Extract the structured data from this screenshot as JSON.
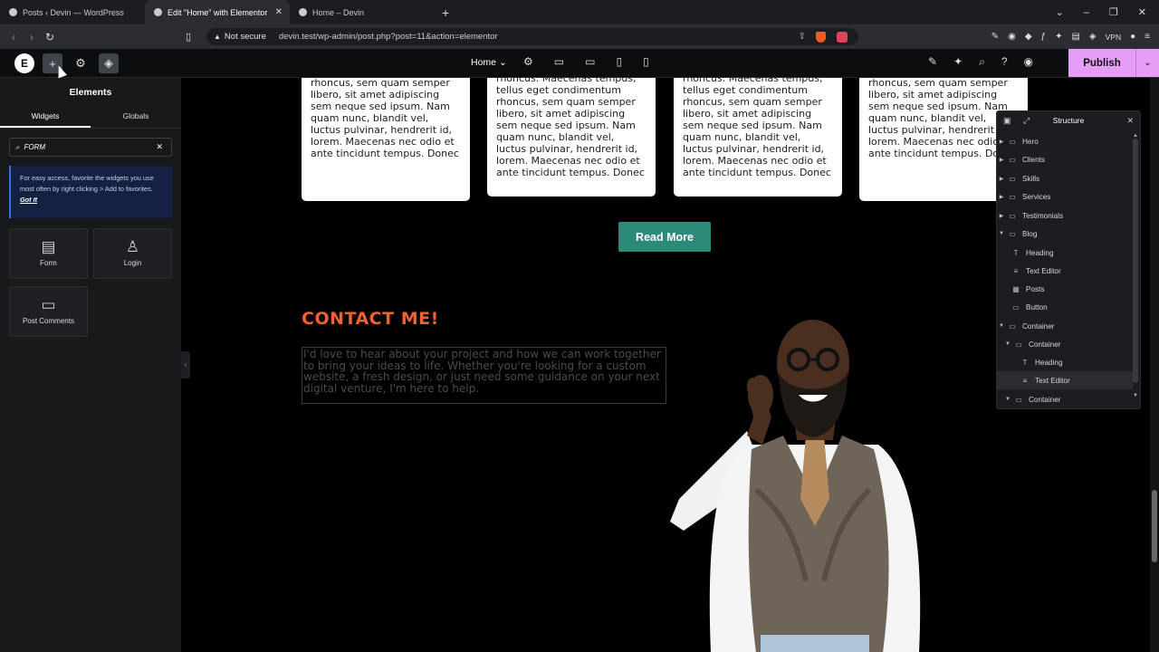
{
  "browser": {
    "tabs": [
      {
        "title": "Posts ‹ Devin — WordPress",
        "active": false
      },
      {
        "title": "Edit \"Home\" with Elementor",
        "active": true
      },
      {
        "title": "Home – Devin",
        "active": false
      }
    ],
    "new_tab": "+",
    "security": "Not secure",
    "url": "devin.test/wp-admin/post.php?post=11&action=elementor",
    "vpn_label": "VPN",
    "window_controls": [
      "⌄",
      "–",
      "❐",
      "✕"
    ]
  },
  "editor": {
    "page_selector": "Home",
    "publish_label": "Publish",
    "publish_color": "#e59df5"
  },
  "panel": {
    "title": "Elements",
    "tabs": [
      "Widgets",
      "Globals"
    ],
    "search_value": "FORM",
    "tip_text": "For easy access, favorite the widgets you use most often by right clicking > Add to favorites.",
    "tip_link": "Got It",
    "widgets": [
      {
        "label": "Form",
        "icon": "form-icon"
      },
      {
        "label": "Login",
        "icon": "login-icon"
      },
      {
        "label": "Post Comments",
        "icon": "comments-icon"
      }
    ]
  },
  "canvas": {
    "cards": [
      {
        "text": "rhoncus, sem quam semper libero, sit amet adipiscing sem neque sed ipsum. Nam quam nunc, blandit vel, luctus pulvinar, hendrerit id, lorem. Maecenas nec odio et ante tincidunt tempus. Donec"
      },
      {
        "text": "rhoncus. Maecenas tempus, tellus eget condimentum rhoncus, sem quam semper libero, sit amet adipiscing sem neque sed ipsum. Nam quam nunc, blandit vel, luctus pulvinar, hendrerit id, lorem. Maecenas nec odio et ante tincidunt tempus. Donec"
      },
      {
        "text": "rhoncus. Maecenas tempus, tellus eget condimentum rhoncus, sem quam semper libero, sit amet adipiscing sem neque sed ipsum. Nam quam nunc, blandit vel, luctus pulvinar, hendrerit id, lorem. Maecenas nec odio et ante tincidunt tempus. Donec"
      },
      {
        "text": "rhoncus, sem quam semper libero, sit amet adipiscing sem neque sed ipsum. Nam quam nunc, blandit vel, luctus pulvinar, hendrerit id, lorem. Maecenas nec odio et ante tincidunt tempus. Donec"
      }
    ],
    "read_more": "Read More",
    "contact_heading": "CONTACT ME!",
    "contact_text": "I'd love to hear about your project and how we can work together to bring your ideas to life. Whether you're looking for a custom website, a fresh design, or just need some guidance on your next digital venture, I'm here to help.",
    "accent_color": "#f0612f",
    "button_color": "#2b8a7a"
  },
  "structure": {
    "title": "Structure",
    "items": [
      {
        "label": "Hero",
        "type": "container",
        "level": 0,
        "expanded": false
      },
      {
        "label": "Clients",
        "type": "container",
        "level": 0,
        "expanded": false
      },
      {
        "label": "Skills",
        "type": "container",
        "level": 0,
        "expanded": false
      },
      {
        "label": "Services",
        "type": "container",
        "level": 0,
        "expanded": false
      },
      {
        "label": "Testimonials",
        "type": "container",
        "level": 0,
        "expanded": false
      },
      {
        "label": "Blog",
        "type": "container",
        "level": 0,
        "expanded": true
      },
      {
        "label": "Heading",
        "type": "heading",
        "level": 1
      },
      {
        "label": "Text Editor",
        "type": "text",
        "level": 1
      },
      {
        "label": "Posts",
        "type": "posts",
        "level": 1
      },
      {
        "label": "Button",
        "type": "button",
        "level": 1
      },
      {
        "label": "Container",
        "type": "container",
        "level": 0,
        "expanded": true
      },
      {
        "label": "Container",
        "type": "container",
        "level": 1,
        "expanded": true
      },
      {
        "label": "Heading",
        "type": "heading",
        "level": 2
      },
      {
        "label": "Text Editor",
        "type": "text",
        "level": 2,
        "highlighted": true
      },
      {
        "label": "Container",
        "type": "container",
        "level": 1,
        "expanded": true
      }
    ]
  }
}
